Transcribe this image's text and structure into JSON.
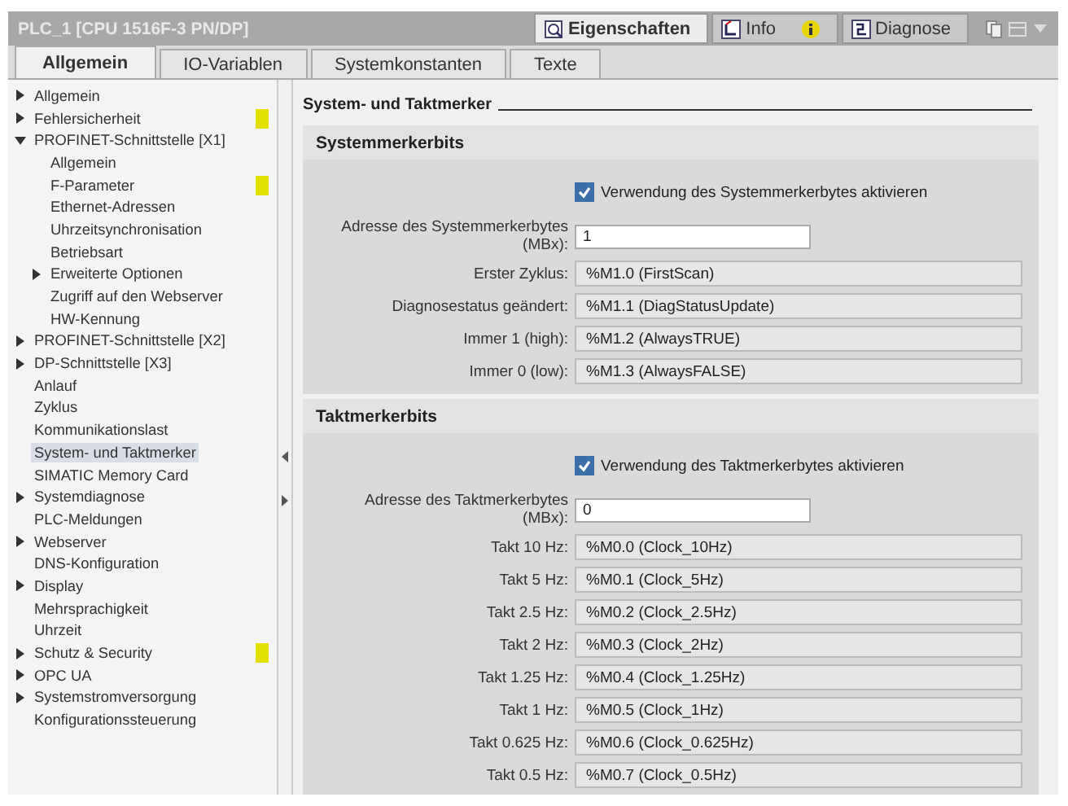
{
  "window": {
    "title": "PLC_1 [CPU 1516F-3 PN/DP]"
  },
  "inspector_tabs": [
    {
      "label": "Eigenschaften",
      "selected": true,
      "kind": "properties"
    },
    {
      "label": "Info",
      "selected": false,
      "kind": "info"
    },
    {
      "label": "Diagnose",
      "selected": false,
      "kind": "diagnostics"
    }
  ],
  "tabs": [
    {
      "label": "Allgemein",
      "selected": true
    },
    {
      "label": "IO-Variablen",
      "selected": false
    },
    {
      "label": "Systemkonstanten",
      "selected": false
    },
    {
      "label": "Texte",
      "selected": false
    }
  ],
  "sidebar": {
    "items": [
      {
        "label": "Allgemein",
        "expanded": false,
        "flagged": false,
        "selected": false
      },
      {
        "label": "Fehlersicherheit",
        "expanded": false,
        "flagged": true,
        "selected": false
      },
      {
        "label": "PROFINET-Schnittstelle [X1]",
        "expanded": true,
        "flagged": false,
        "selected": false,
        "children": [
          {
            "label": "Allgemein",
            "flagged": false,
            "selected": false
          },
          {
            "label": "F-Parameter",
            "flagged": true,
            "selected": false
          },
          {
            "label": "Ethernet-Adressen",
            "flagged": false,
            "selected": false
          },
          {
            "label": "Uhrzeitsynchronisation",
            "flagged": false,
            "selected": false
          },
          {
            "label": "Betriebsart",
            "flagged": false,
            "selected": false
          },
          {
            "label": "Erweiterte Optionen",
            "expanded": false,
            "flagged": false,
            "selected": false
          },
          {
            "label": "Zugriff auf den Webserver",
            "flagged": false,
            "selected": false
          },
          {
            "label": "HW-Kennung",
            "flagged": false,
            "selected": false
          }
        ]
      },
      {
        "label": "PROFINET-Schnittstelle [X2]",
        "expanded": false,
        "flagged": false,
        "selected": false
      },
      {
        "label": "DP-Schnittstelle [X3]",
        "expanded": false,
        "flagged": false,
        "selected": false
      },
      {
        "label": "Anlauf",
        "flagged": false,
        "selected": false
      },
      {
        "label": "Zyklus",
        "flagged": false,
        "selected": false
      },
      {
        "label": "Kommunikationslast",
        "flagged": false,
        "selected": false
      },
      {
        "label": "System- und Taktmerker",
        "flagged": false,
        "selected": true
      },
      {
        "label": "SIMATIC Memory Card",
        "flagged": false,
        "selected": false
      },
      {
        "label": "Systemdiagnose",
        "expanded": false,
        "flagged": false,
        "selected": false
      },
      {
        "label": "PLC-Meldungen",
        "flagged": false,
        "selected": false
      },
      {
        "label": "Webserver",
        "expanded": false,
        "flagged": false,
        "selected": false
      },
      {
        "label": "DNS-Konfiguration",
        "flagged": false,
        "selected": false
      },
      {
        "label": "Display",
        "expanded": false,
        "flagged": false,
        "selected": false
      },
      {
        "label": "Mehrsprachigkeit",
        "flagged": false,
        "selected": false
      },
      {
        "label": "Uhrzeit",
        "flagged": false,
        "selected": false
      },
      {
        "label": "Schutz & Security",
        "expanded": false,
        "flagged": true,
        "selected": false
      },
      {
        "label": "OPC UA",
        "expanded": false,
        "flagged": false,
        "selected": false
      },
      {
        "label": "Systemstromversorgung",
        "expanded": false,
        "flagged": false,
        "selected": false
      },
      {
        "label": "Konfigurationssteuerung",
        "flagged": false,
        "selected": false
      }
    ]
  },
  "page_title": "System- und Taktmerker",
  "sections": [
    {
      "title": "Systemmerkerbits",
      "checkbox": {
        "label": "Verwendung des Systemmerkerbytes aktivieren",
        "checked": true
      },
      "address": {
        "label": "Adresse des Systemmerkerbytes (MBx):",
        "value": "1"
      },
      "rows": [
        {
          "label": "Erster Zyklus:",
          "value": "%M1.0 (FirstScan)"
        },
        {
          "label": "Diagnosestatus geändert:",
          "value": "%M1.1 (DiagStatusUpdate)"
        },
        {
          "label": "Immer 1 (high):",
          "value": "%M1.2 (AlwaysTRUE)"
        },
        {
          "label": "Immer 0 (low):",
          "value": "%M1.3 (AlwaysFALSE)"
        }
      ]
    },
    {
      "title": "Taktmerkerbits",
      "checkbox": {
        "label": "Verwendung des Taktmerkerbytes aktivieren",
        "checked": true
      },
      "address": {
        "label": "Adresse des Taktmerkerbytes (MBx):",
        "value": "0"
      },
      "rows": [
        {
          "label": "Takt 10 Hz:",
          "value": "%M0.0 (Clock_10Hz)"
        },
        {
          "label": "Takt 5 Hz:",
          "value": "%M0.1 (Clock_5Hz)"
        },
        {
          "label": "Takt 2.5 Hz:",
          "value": "%M0.2 (Clock_2.5Hz)"
        },
        {
          "label": "Takt 2 Hz:",
          "value": "%M0.3 (Clock_2Hz)"
        },
        {
          "label": "Takt 1.25 Hz:",
          "value": "%M0.4 (Clock_1.25Hz)"
        },
        {
          "label": "Takt 1 Hz:",
          "value": "%M0.5 (Clock_1Hz)"
        },
        {
          "label": "Takt 0.625 Hz:",
          "value": "%M0.6 (Clock_0.625Hz)"
        },
        {
          "label": "Takt 0.5 Hz:",
          "value": "%M0.7 (Clock_0.5Hz)"
        }
      ]
    }
  ]
}
